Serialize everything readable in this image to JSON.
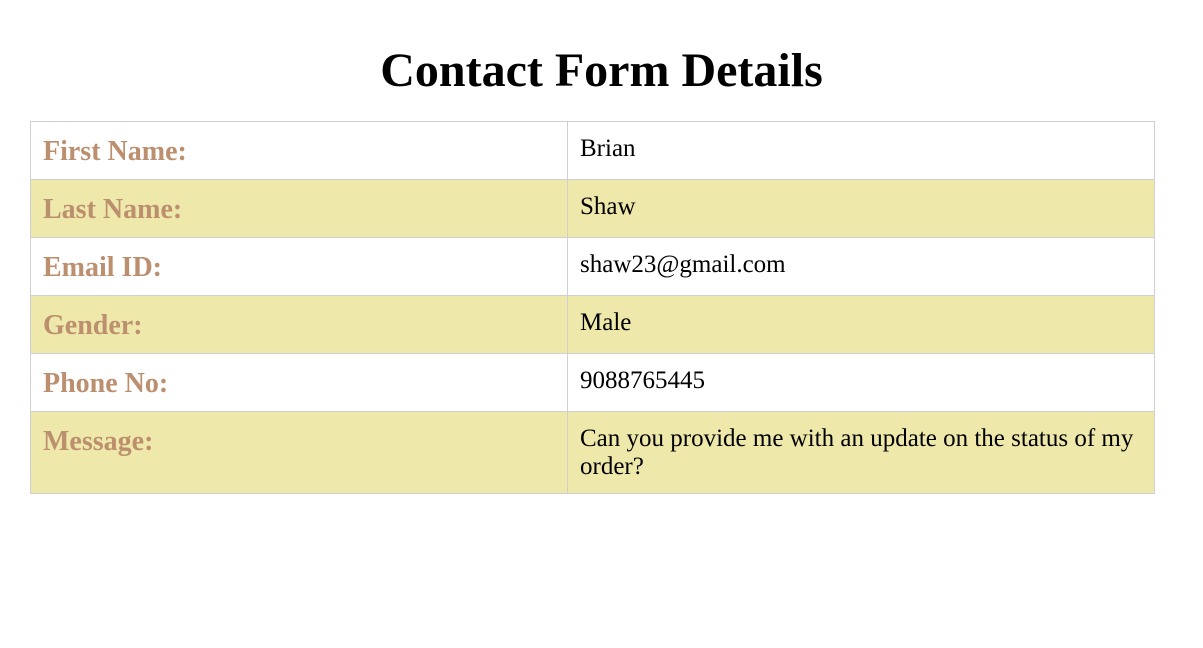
{
  "page": {
    "title": "Contact Form Details"
  },
  "rows": [
    {
      "label": "First Name:",
      "value": "Brian"
    },
    {
      "label": "Last Name:",
      "value": "Shaw"
    },
    {
      "label": "Email ID:",
      "value": "shaw23@gmail.com"
    },
    {
      "label": "Gender:",
      "value": "Male"
    },
    {
      "label": "Phone No:",
      "value": "9088765445"
    },
    {
      "label": "Message:",
      "value": "Can you provide me with an update on the status of my order?"
    }
  ],
  "colors": {
    "label_text": "#bc8f6f",
    "striped_row": "#eee8aa",
    "border": "#d0d0d0"
  }
}
